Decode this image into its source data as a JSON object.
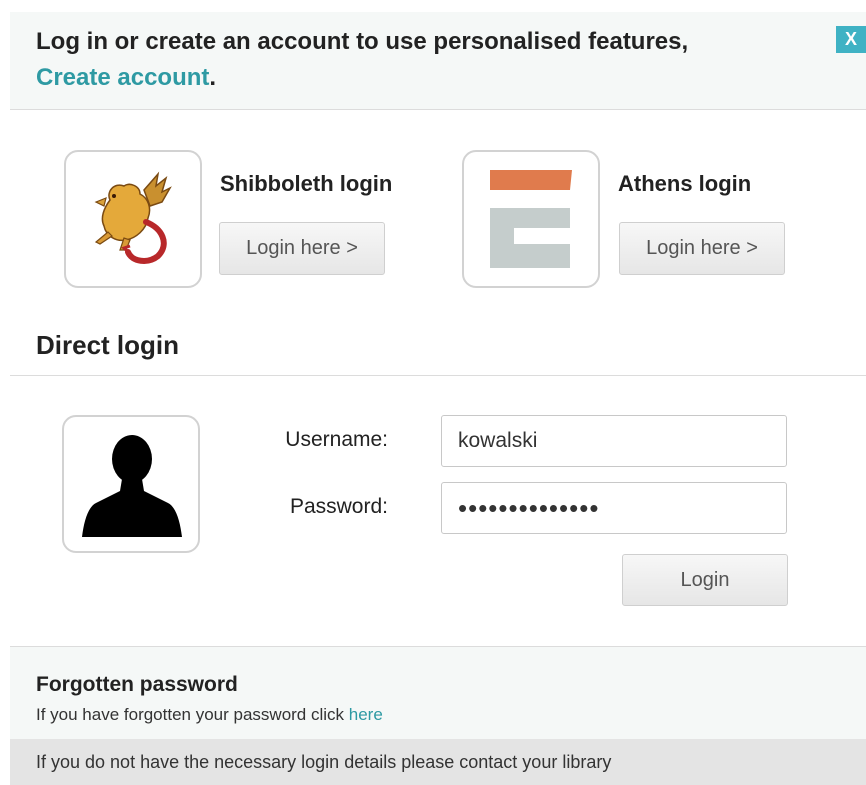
{
  "header": {
    "line1": "Log in or create an account to use personalised features,",
    "create_link": "Create account",
    "period": ".",
    "close_label": "X"
  },
  "shibboleth": {
    "title": "Shibboleth login",
    "button": "Login here >",
    "icon": "griffin-logo-icon"
  },
  "athens": {
    "title": "Athens login",
    "button": "Login here >",
    "icon": "athens-logo-icon",
    "colors": {
      "top": "#e07b4d",
      "body": "#c5cdcc"
    }
  },
  "direct": {
    "title": "Direct login",
    "username_label": "Username:",
    "username_value": "kowalski",
    "password_label": "Password:",
    "password_value": "••••••••••••••",
    "login_button": "Login",
    "icon": "user-silhouette-icon"
  },
  "forgot": {
    "title": "Forgotten password",
    "text": "If you have forgotten your password click ",
    "link": "here"
  },
  "footer": {
    "text": "If you do not have the necessary login details please contact your library"
  },
  "colors": {
    "accent": "#2e9aa3",
    "close_button": "#3fb2c4"
  }
}
